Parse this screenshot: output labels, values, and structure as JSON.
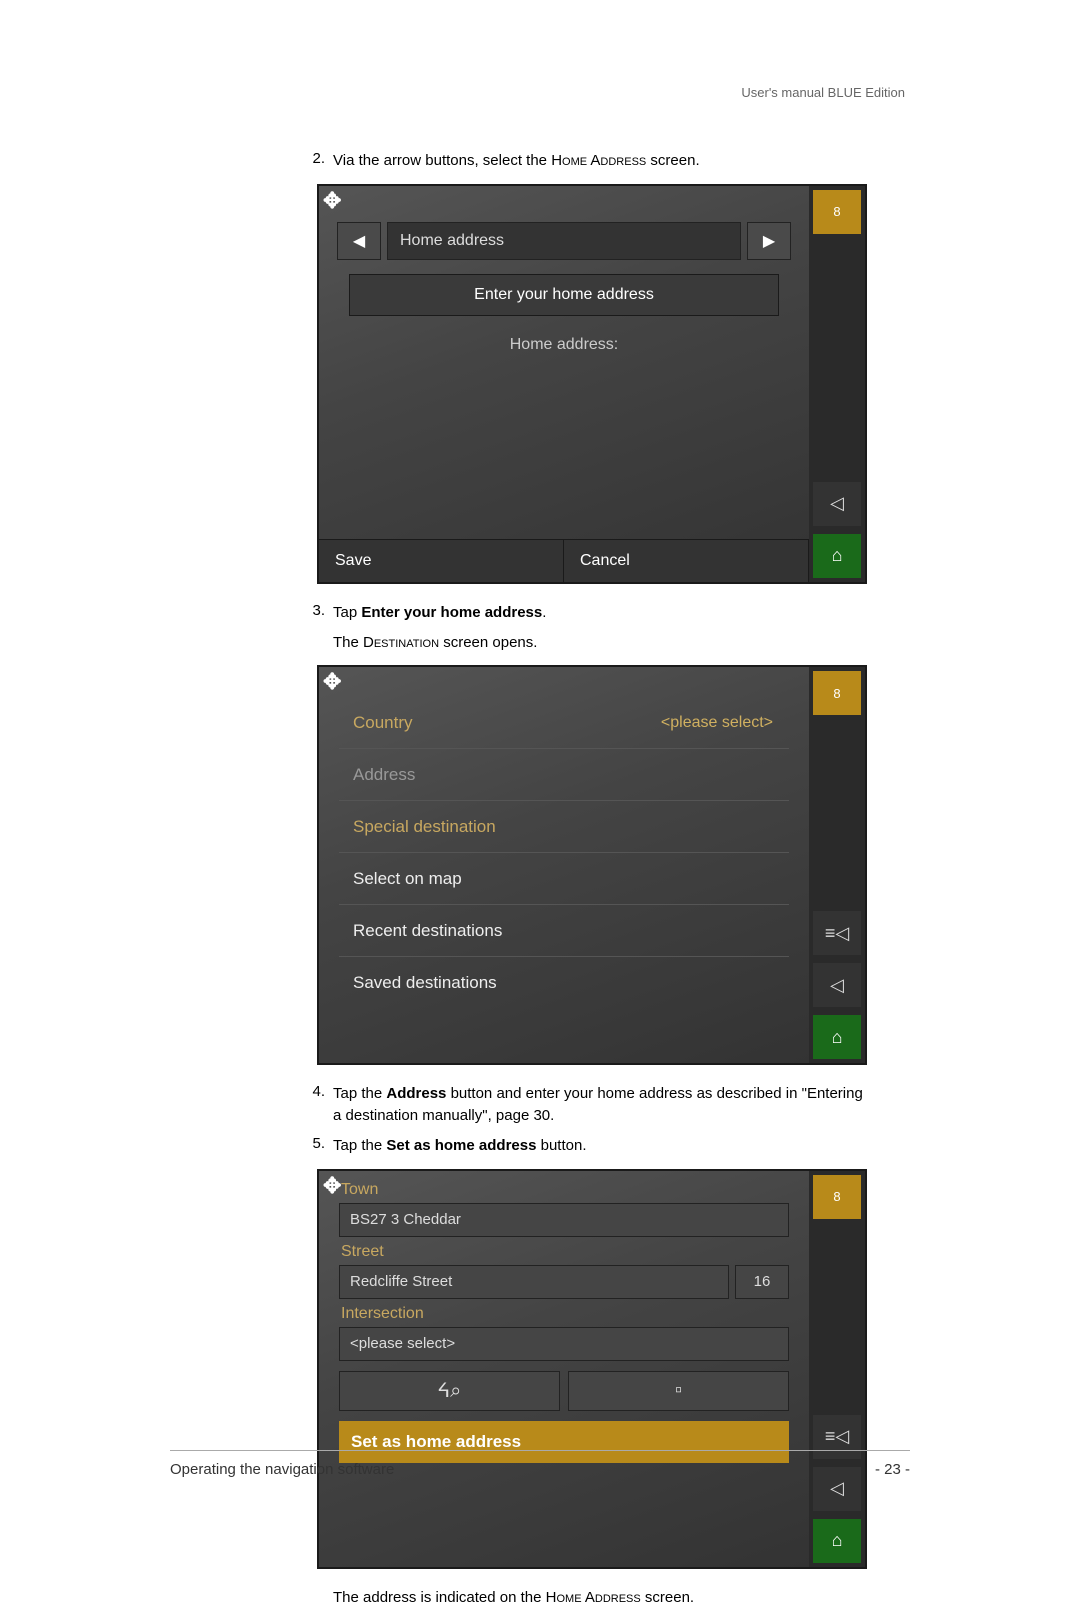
{
  "header": {
    "right": "User's manual BLUE Edition"
  },
  "steps": {
    "s2": {
      "num": "2.",
      "pre": "Via the arrow buttons, select the ",
      "caps": "Home Address",
      "post": " screen."
    },
    "s3": {
      "num": "3.",
      "pre": "Tap ",
      "bold": "Enter your home address",
      "post": "."
    },
    "s3_sub_pre": "The ",
    "s3_sub_caps": "Destination",
    "s3_sub_post": " screen opens.",
    "s4": {
      "num": "4.",
      "pre": "Tap the ",
      "bold": "Address",
      "post": " button and enter your home address as described in \"Entering a destination manually\", page 30."
    },
    "s5": {
      "num": "5.",
      "pre": "Tap the ",
      "bold": "Set as home address",
      "post": " button."
    },
    "after5_pre": "The address is indicated on the ",
    "after5_caps": "Home Address",
    "after5_post": " screen."
  },
  "dev1": {
    "tab_label": "Home address",
    "enter_btn": "Enter your home address",
    "mid_label": "Home address:",
    "save": "Save",
    "cancel": "Cancel",
    "side_badge": "8"
  },
  "dev2": {
    "country": "Country",
    "country_val": "<please select>",
    "address": "Address",
    "special": "Special destination",
    "select_map": "Select on map",
    "recent": "Recent destinations",
    "saved": "Saved destinations",
    "side_badge": "8"
  },
  "dev3": {
    "town_label": "Town",
    "town_val": "BS27 3 Cheddar",
    "street_label": "Street",
    "street_val": "Redcliffe Street",
    "street_num": "16",
    "inter_label": "Intersection",
    "inter_val": "<please select>",
    "set_home": "Set as home address",
    "side_badge": "8"
  },
  "footer": {
    "left": "Operating the navigation software",
    "right": "- 23 -"
  }
}
